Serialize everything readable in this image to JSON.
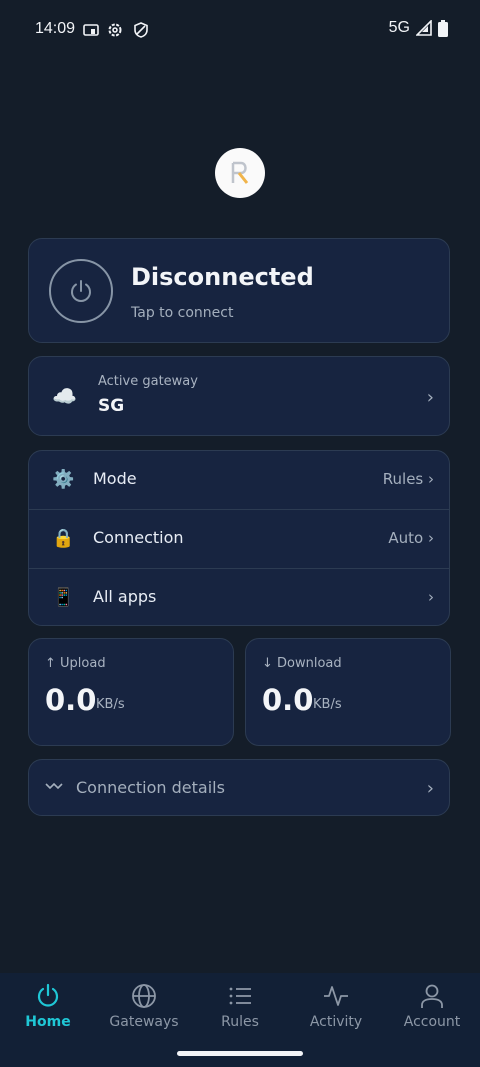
{
  "status_bar": {
    "time": "14:09",
    "network": "5G",
    "icons": [
      "cast-icon",
      "settings-gear-icon",
      "vpn-shield-icon",
      "signal-icon",
      "battery-icon"
    ]
  },
  "logo": {
    "icon": "app-logo-r"
  },
  "connection": {
    "status": "Disconnected",
    "hint": "Tap to connect",
    "icon": "power-icon"
  },
  "gateway": {
    "label": "Active gateway",
    "value": "SG",
    "icon": "cloud-icon",
    "chevron": "›"
  },
  "settings": {
    "rows": [
      {
        "label": "Mode",
        "value": "Rules ›",
        "icon": "gear-icon"
      },
      {
        "label": "Connection",
        "value": "Auto ›",
        "icon": "lock-icon"
      },
      {
        "label": "All apps",
        "value": "›",
        "icon": "phone-icon"
      }
    ]
  },
  "speed": {
    "upload": {
      "label": "↑ Upload",
      "value": "0.0",
      "unit": "KB/s"
    },
    "download": {
      "label": "↓ Download",
      "value": "0.0",
      "unit": "KB/s"
    }
  },
  "details": {
    "label": "Connection details",
    "icon": "wave-icon",
    "chevron": "›"
  },
  "nav": {
    "items": [
      {
        "label": "Home",
        "icon": "power-icon",
        "active": true
      },
      {
        "label": "Gateways",
        "icon": "globe-icon",
        "active": false
      },
      {
        "label": "Rules",
        "icon": "list-icon",
        "active": false
      },
      {
        "label": "Activity",
        "icon": "activity-icon",
        "active": false
      },
      {
        "label": "Account",
        "icon": "user-icon",
        "active": false
      }
    ]
  },
  "colors": {
    "background": "#141d29",
    "card": "#172440",
    "accent": "#1fc7d6",
    "muted": "#a4afbd"
  }
}
